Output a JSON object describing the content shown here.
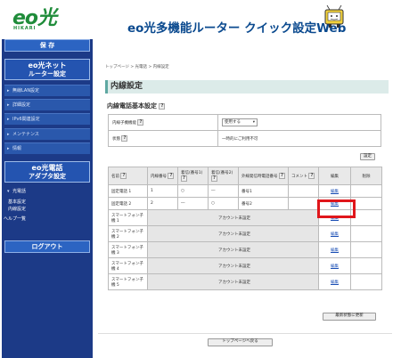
{
  "header": {
    "logo_text": "eo光",
    "logo_sub": "HIKARI",
    "title": "eo光多機能ルーター クイック設定Web"
  },
  "sidebar": {
    "save_label": "保 存",
    "net_head_l1": "eo光ネット",
    "net_head_l2": "ルーター設定",
    "net_items": [
      "無線LAN設定",
      "詳細設定",
      "IPv6関連設定",
      "メンテナンス",
      "情報"
    ],
    "phone_head_l1": "eo光電話",
    "phone_head_l2": "アダプタ設定",
    "phone_items": [
      "光電話"
    ],
    "phone_sub_items": [
      "基本設定",
      "内線設定"
    ],
    "help_label": "ヘルプ一覧",
    "logout_label": "ログアウト"
  },
  "main": {
    "breadcrumb": "トップページ > 光電話 > 内線設定",
    "section_title": "内線設定",
    "sub_title": "内線電話基本設定",
    "help_glyph": "?",
    "basic": {
      "row1_label": "内線子機機能",
      "row1_value": "使用する",
      "row2_label": "状態",
      "row2_value": "一時的にご利用不可"
    },
    "setting_button": "設定",
    "table_headers": [
      "名前",
      "内線番号",
      "着信(番号1)",
      "着信(番号2)",
      "外線発信時電話番号",
      "コメント",
      "編集",
      "削除"
    ],
    "rows": [
      {
        "name": "固定電話 1",
        "ext": "1",
        "in1": "○",
        "in2": "―",
        "out": "番号1",
        "comment": "",
        "edit": "編集",
        "del": "",
        "unset": false
      },
      {
        "name": "固定電話 2",
        "ext": "2",
        "in1": "―",
        "in2": "○",
        "out": "番号2",
        "comment": "",
        "edit": "編集",
        "del": "",
        "unset": false
      },
      {
        "name": "スマートフォン子機 1",
        "unset_text": "アカウント未設定",
        "edit": "編集",
        "unset": true
      },
      {
        "name": "スマートフォン子機 2",
        "unset_text": "アカウント未設定",
        "edit": "編集",
        "unset": true
      },
      {
        "name": "スマートフォン子機 3",
        "unset_text": "アカウント未設定",
        "edit": "編集",
        "unset": true
      },
      {
        "name": "スマートフォン子機 4",
        "unset_text": "アカウント未設定",
        "edit": "編集",
        "unset": true
      },
      {
        "name": "スマートフォン子機 5",
        "unset_text": "アカウント未設定",
        "edit": "編集",
        "unset": true
      }
    ],
    "refresh_button": "最新状態に更新",
    "back_button": "トップページへ戻る"
  },
  "colors": {
    "sidebar_bg": "#1c3a87",
    "accent_green": "#1f8c3a",
    "title_blue": "#0b4a8f",
    "highlight_red": "#e0161b"
  }
}
